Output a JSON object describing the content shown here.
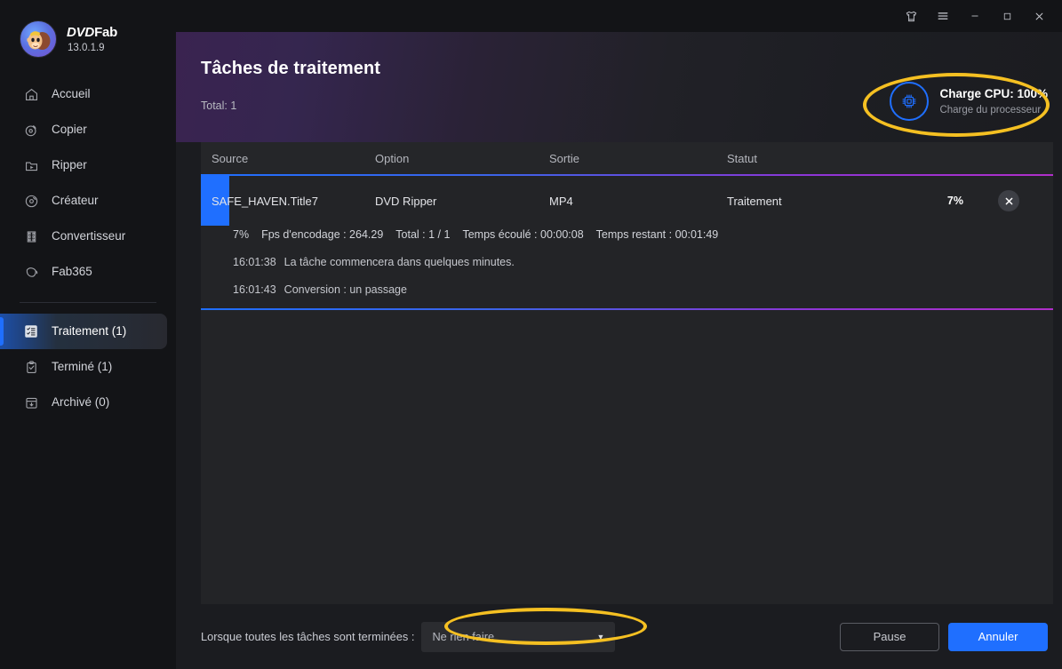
{
  "brand": {
    "name_dvd": "DVD",
    "name_fab": "Fab",
    "version": "13.0.1.9",
    "logo_icon": "monkey-avatar-icon"
  },
  "titlebar": {
    "theme_icon": "tshirt-icon",
    "menu_icon": "hamburger-menu-icon",
    "minimize_icon": "minimize-icon",
    "maximize_icon": "maximize-icon",
    "close_icon": "close-icon"
  },
  "sidebar": {
    "items": [
      {
        "label": "Accueil",
        "icon": "home-icon",
        "active": false
      },
      {
        "label": "Copier",
        "icon": "disc-copy-icon",
        "active": false
      },
      {
        "label": "Ripper",
        "icon": "rip-folder-icon",
        "active": false
      },
      {
        "label": "Créateur",
        "icon": "disc-create-icon",
        "active": false
      },
      {
        "label": "Convertisseur",
        "icon": "film-strip-icon",
        "active": false
      },
      {
        "label": "Fab365",
        "icon": "fab365-icon",
        "active": false
      }
    ],
    "items_bottom": [
      {
        "label": "Traitement (1)",
        "icon": "task-list-icon",
        "active": true
      },
      {
        "label": "Terminé (1)",
        "icon": "clipboard-check-icon",
        "active": false
      },
      {
        "label": "Archivé (0)",
        "icon": "archive-box-icon",
        "active": false
      }
    ]
  },
  "header": {
    "title": "Tâches de traitement",
    "total": "Total: 1",
    "cpu": {
      "icon": "cpu-chip-icon",
      "main": "Charge CPU: 100%",
      "sub": "Charge du processeur"
    }
  },
  "table": {
    "columns": [
      "Source",
      "Option",
      "Sortie",
      "Statut"
    ],
    "rows": [
      {
        "source": "SAFE_HAVEN.Title7",
        "option": "DVD Ripper",
        "sortie": "MP4",
        "statut": "Traitement",
        "progress_label": "7%",
        "progress_percent": 7,
        "cancel_icon": "close-circle-icon",
        "detail": {
          "stats": [
            "7%",
            "Fps d'encodage : 264.29",
            "Total : 1 / 1",
            "Temps écoulé : 00:00:08",
            "Temps restant : 00:01:49"
          ],
          "logs": [
            {
              "time": "16:01:38",
              "message": "La tâche commencera dans quelques minutes."
            },
            {
              "time": "16:01:43",
              "message": "Conversion : un passage"
            }
          ]
        }
      }
    ]
  },
  "footer": {
    "label": "Lorsque toutes les tâches sont terminées :",
    "dropdown_value": "Ne rien faire",
    "dropdown_caret_icon": "chevron-down-icon",
    "pause_label": "Pause",
    "cancel_label": "Annuler"
  },
  "colors": {
    "accent_blue": "#1f6fff",
    "annotation_yellow": "#f5c022",
    "gradient_purple": "#b02fc9",
    "sidebar_bg": "#131417",
    "panel_bg": "#232427"
  }
}
